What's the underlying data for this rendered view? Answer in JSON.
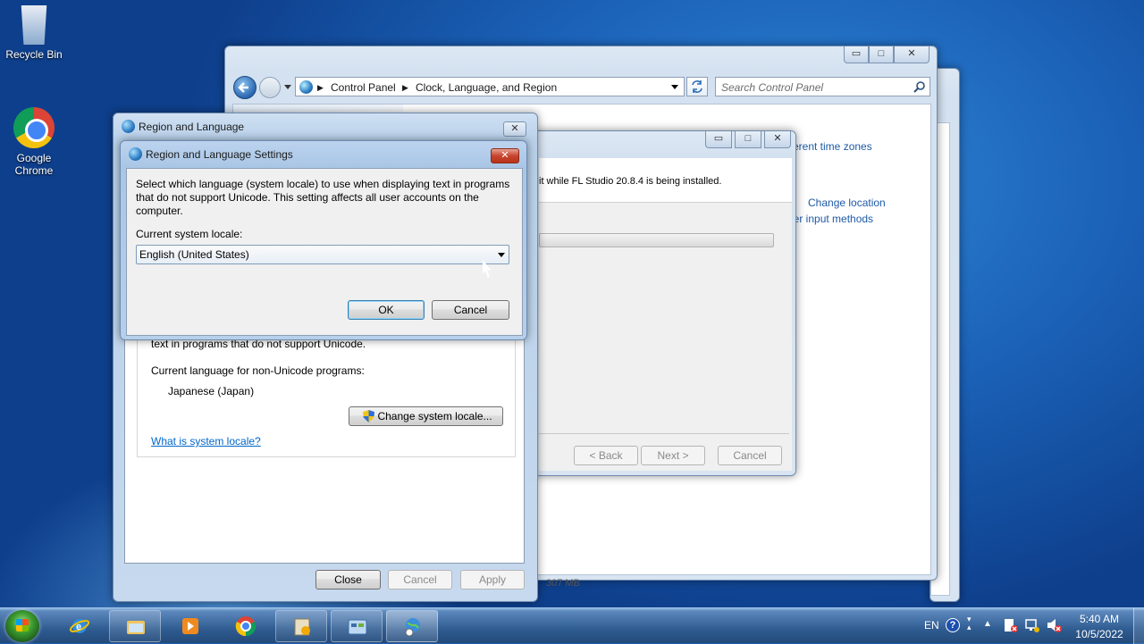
{
  "desktop": {
    "icons": [
      {
        "label": "Recycle Bin"
      },
      {
        "label": "Google Chrome"
      }
    ]
  },
  "control_panel": {
    "breadcrumb": [
      "Control Panel",
      "Clock, Language, and Region"
    ],
    "search_placeholder": "Search Control Panel",
    "links": {
      "time_zones": "erent time zones",
      "change_location": "Change location",
      "input_methods": "her input methods"
    }
  },
  "installer": {
    "message": "it while FL Studio 20.8.4 is being installed.",
    "progress_fraction": 0,
    "buttons": {
      "back": "< Back",
      "next": "Next >",
      "cancel": "Cancel"
    },
    "partial_bottom": "307 MB"
  },
  "region_language": {
    "title": "Region and Language",
    "unicode_text": "text in programs that do not support Unicode.",
    "current_label": "Current language for non-Unicode programs:",
    "current_value": "Japanese (Japan)",
    "change_locale_button": "Change system locale...",
    "system_locale_link": "What is system locale?",
    "buttons": {
      "close": "Close",
      "cancel": "Cancel",
      "apply": "Apply"
    }
  },
  "settings_dialog": {
    "title": "Region and Language Settings",
    "description": "Select which language (system locale) to use when displaying text in programs that do not support Unicode. This setting affects all user accounts on the computer.",
    "locale_label": "Current system locale:",
    "locale_value": "English (United States)",
    "ok": "OK",
    "cancel": "Cancel"
  },
  "taskbar": {
    "language": "EN",
    "time": "5:40 AM",
    "date": "10/5/2022"
  },
  "colors": {
    "desktop_blue": "#1e5fb4",
    "link_blue": "#0066cc",
    "close_red": "#c7452f"
  }
}
